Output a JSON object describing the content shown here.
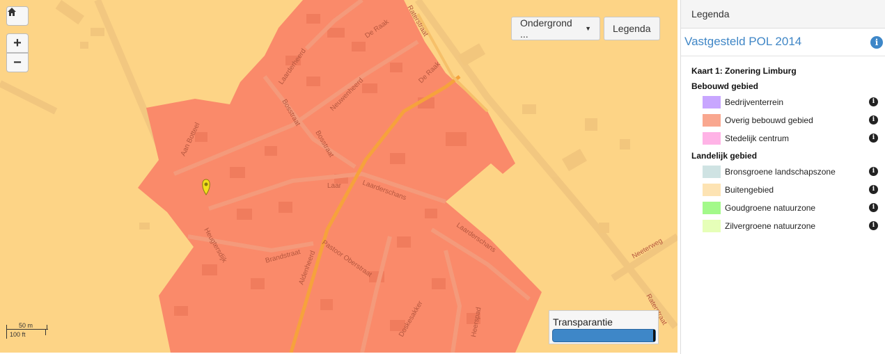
{
  "map": {
    "place_label": "Laar",
    "streets": [
      "Raterstraat",
      "De Raak",
      "Laarderheerd",
      "Neuwenheerd",
      "Bosstraat",
      "Aan Botteel",
      "De Raak",
      "Bosstraat",
      "Laarderschans",
      "Laarderschans",
      "Heugtersdijk",
      "Brandstraat",
      "Aldenheerd",
      "Pastoor Oberstraat",
      "Doskesakker",
      "Heerspad",
      "Neeterweg",
      "Raterstraat"
    ],
    "buttons": {
      "home_icon": "home-icon",
      "zoom_in": "+",
      "zoom_out": "−",
      "ondergrond": "Ondergrond ...",
      "legenda": "Legenda"
    },
    "scale": {
      "metric": "50 m",
      "imperial": "100 ft"
    },
    "transparency": {
      "label": "Transparantie",
      "value": 1.0
    },
    "colors": {
      "background": "#fdd486",
      "zone": "#fa8a6a",
      "road": "#e8c47a",
      "road_main": "#f6a23c"
    }
  },
  "panel": {
    "header": "Legenda",
    "title": "Vastgesteld POL 2014",
    "map_title": "Kaart 1: Zonering Limburg",
    "groups": [
      {
        "title": "Bebouwd gebied",
        "items": [
          {
            "label": "Bedrijventerrein",
            "color": "#c8a6ff"
          },
          {
            "label": "Overig bebouwd gebied",
            "color": "#f9a78f"
          },
          {
            "label": "Stedelijk centrum",
            "color": "#ffb3e6"
          }
        ]
      },
      {
        "title": "Landelijk gebied",
        "items": [
          {
            "label": "Bronsgroene landschapszone",
            "color": "#cfe3e3"
          },
          {
            "label": "Buitengebied",
            "color": "#fde3b3"
          },
          {
            "label": "Goudgroene natuurzone",
            "color": "#a3f98a"
          },
          {
            "label": "Zilvergroene natuurzone",
            "color": "#e6ffb8"
          }
        ]
      }
    ]
  }
}
